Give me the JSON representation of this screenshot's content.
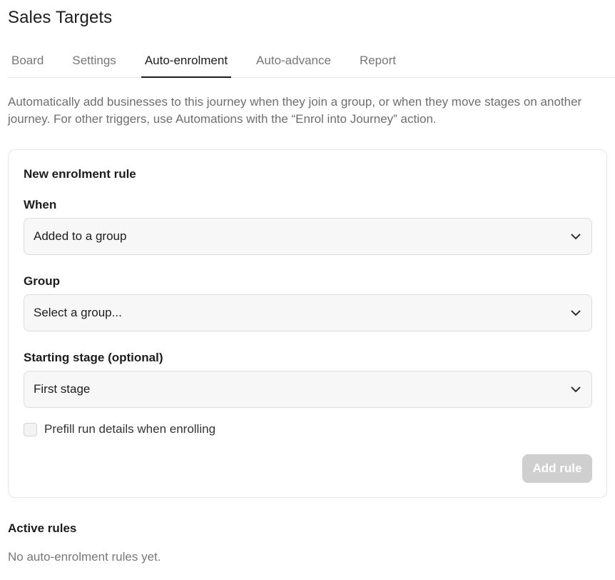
{
  "page": {
    "title": "Sales Targets"
  },
  "tabs": [
    {
      "label": "Board",
      "active": false
    },
    {
      "label": "Settings",
      "active": false
    },
    {
      "label": "Auto-enrolment",
      "active": true
    },
    {
      "label": "Auto-advance",
      "active": false
    },
    {
      "label": "Report",
      "active": false
    }
  ],
  "description": "Automatically add businesses to this journey when they join a group, or when they move stages on another journey. For other triggers, use Automations with the “Enrol into Journey” action.",
  "rule_form": {
    "title": "New enrolment rule",
    "when": {
      "label": "When",
      "value": "Added to a group"
    },
    "group": {
      "label": "Group",
      "value": "Select a group..."
    },
    "starting_stage": {
      "label": "Starting stage (optional)",
      "value": "First stage"
    },
    "prefill_checkbox": {
      "label": "Prefill run details when enrolling",
      "checked": false
    },
    "add_button_label": "Add rule"
  },
  "active_rules": {
    "title": "Active rules",
    "empty_text": "No auto-enrolment rules yet."
  },
  "colors": {
    "accent": "#1d1d1d",
    "muted_text": "#777777",
    "disabled_button": "#cfcfcf"
  }
}
